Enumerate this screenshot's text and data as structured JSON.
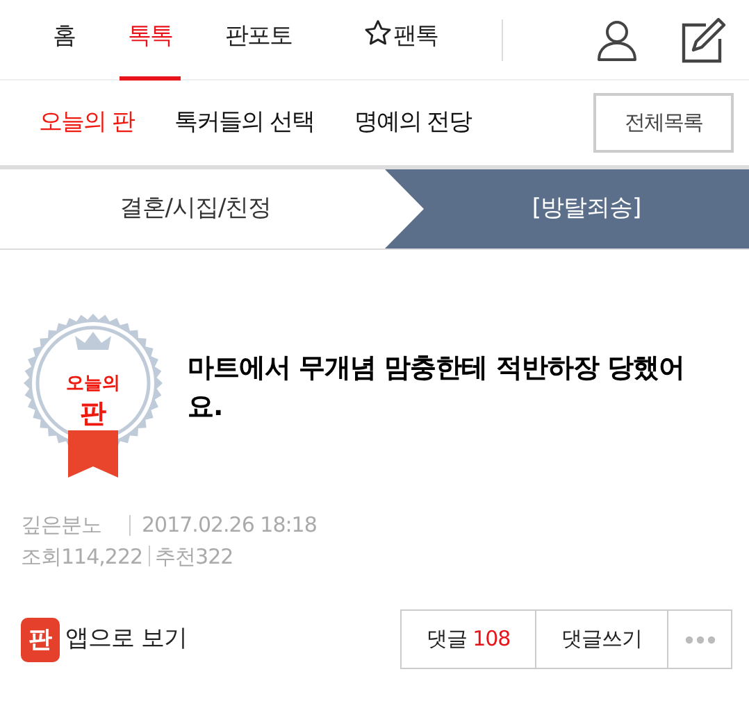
{
  "top_nav": [
    {
      "label": "홈",
      "selected": false,
      "kind": "text"
    },
    {
      "label": "톡톡",
      "selected": true,
      "kind": "text"
    },
    {
      "label": "판포토",
      "selected": false,
      "kind": "text"
    },
    {
      "label": "팬톡",
      "selected": false,
      "kind": "star"
    }
  ],
  "sub_nav": [
    {
      "label": "오늘의 판",
      "selected": true
    },
    {
      "label": "톡커들의 선택",
      "selected": false
    },
    {
      "label": "명예의 전당",
      "selected": false
    }
  ],
  "all_list_button": "전체목록",
  "categories": [
    {
      "label": "결혼/시집/친정",
      "selected": false
    },
    {
      "label": "[방탈죄송]",
      "selected": true
    }
  ],
  "badge": {
    "line_1": "오늘의",
    "line_2": "판"
  },
  "post": {
    "title": "마트에서 무개념 맘충한테 적반하장 당했어요.",
    "author": "깊은분노",
    "date": "2017.02.26 18:18",
    "views": "조회114,222",
    "recommends": "추천322"
  },
  "footer": {
    "app_icon_text": "판",
    "app_link": "앱으로 보기",
    "comments_label": "댓글",
    "comments_count": "108",
    "write_comment": "댓글쓰기"
  }
}
